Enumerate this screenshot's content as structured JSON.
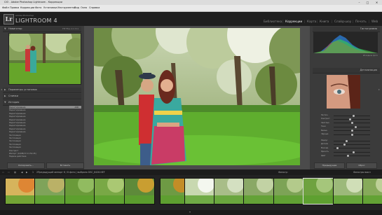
{
  "window": {
    "title": "CIO - Adobe Photoshop Lightroom - Коррекции",
    "controls": [
      "–",
      "□",
      "✕"
    ]
  },
  "menu": [
    "Файл",
    "Правка",
    "Коррекции",
    "Фото",
    "Установки",
    "Инструменты",
    "Вид",
    "Окно",
    "Справка"
  ],
  "identity": {
    "logo": "Lr",
    "subtitle": "Adobe Photoshop",
    "name": "LIGHTROOM 4"
  },
  "modules": [
    {
      "label": "Библиотека",
      "active": false
    },
    {
      "label": "Коррекции",
      "active": true
    },
    {
      "label": "Карта",
      "active": false
    },
    {
      "label": "Книга",
      "active": false
    },
    {
      "label": "Слайд-шоу",
      "active": false
    },
    {
      "label": "Печать",
      "active": false
    },
    {
      "label": "Web",
      "active": false
    }
  ],
  "left_panel": {
    "navigator": {
      "label": "Навигатор",
      "zoom": "FIT  FILL  1:1  3:1"
    },
    "presets_header": "Параметры установок",
    "snapshots_header": "Снимки",
    "history_header": "История",
    "history": [
      {
        "label": "Редактирование",
        "value": "-100",
        "selected": true
      },
      {
        "label": "Редактирование",
        "value": "",
        "selected": false
      },
      {
        "label": "Редактирование",
        "value": "",
        "selected": false
      },
      {
        "label": "Редактирование",
        "value": "",
        "selected": false
      },
      {
        "label": "Редактирование",
        "value": "",
        "selected": false
      },
      {
        "label": "Редактирование",
        "value": "",
        "selected": false
      },
      {
        "label": "Редактирование",
        "value": "",
        "selected": false
      },
      {
        "label": "Редактирование",
        "value": "",
        "selected": false
      },
      {
        "label": "Редактирование",
        "value": "",
        "selected": false
      },
      {
        "label": "Экспозиция",
        "value": "",
        "selected": false
      },
      {
        "label": "Экспозиция",
        "value": "",
        "selected": false
      },
      {
        "label": "Экспозиция",
        "value": "",
        "selected": false
      },
      {
        "label": "Экспозиция",
        "value": "",
        "selected": false
      },
      {
        "label": "Экспозиция",
        "value": "",
        "selected": false
      },
      {
        "label": "Контраст",
        "value": "",
        "selected": false
      },
      {
        "label": "Импорт (14/08/13 11:52:45)",
        "value": "",
        "selected": false
      },
      {
        "label": "Первое действие",
        "value": "",
        "selected": false
      }
    ],
    "copy_button": "Копировать...",
    "paste_button": "Вставить"
  },
  "right_panel": {
    "histogram_label": "Гистограмма",
    "orig_label": "Исходное фото",
    "detail_label": "Детализация",
    "sliders_a": [
      {
        "label": "Экспоз.",
        "pos": 0.55
      },
      {
        "label": "Контраст",
        "pos": 0.45
      },
      {
        "label": "Светлые",
        "pos": 0.5
      },
      {
        "label": "Тени",
        "pos": 0.6
      },
      {
        "label": "Белые",
        "pos": 0.5
      },
      {
        "label": "Чёрные",
        "pos": 0.5
      }
    ],
    "sliders_b": [
      {
        "label": "Радиус",
        "pos": 0.35
      },
      {
        "label": "Детали",
        "pos": 0.3
      },
      {
        "label": "Маскир.",
        "pos": 0.1
      },
      {
        "label": "Яркость",
        "pos": 0.55
      },
      {
        "label": "Цвет",
        "pos": 0.4
      }
    ],
    "prev_button": "Предыдущее",
    "reset_button": "Сброс"
  },
  "filmstrip": {
    "page_buttons": [
      "1",
      "2"
    ],
    "info": "Предыдущий импорт  6 / 8 фото  |  выбрано  DSC_8426.NEF",
    "filter_label": "Фильтр:",
    "filter_value": "Фильтры выкл",
    "selected_index": 10
  },
  "colors": {
    "accent": "#dddddd",
    "panel": "#3b3b3b",
    "background": "#4b4b4b"
  }
}
